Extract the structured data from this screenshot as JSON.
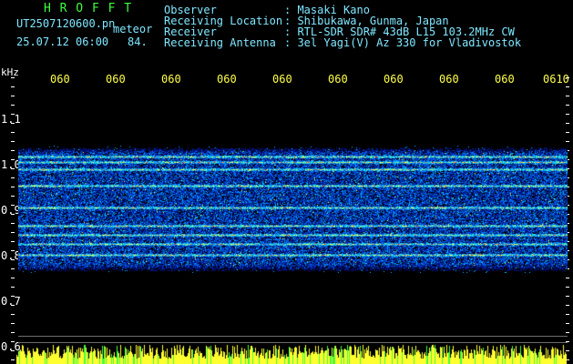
{
  "header": {
    "brand": "H R O F F T",
    "filename": "UT2507120600.pn",
    "meteor_word": "meteor",
    "datetime": "25.07.12 06:00",
    "count": "84.",
    "fields": [
      {
        "label": "Observer",
        "value": ": Masaki Kano"
      },
      {
        "label": "Receiving Location",
        "value": ": Shibukawa, Gunma, Japan"
      },
      {
        "label": "Receiver",
        "value": ": RTL-SDR SDR# 43dB L15 103.2MHz CW"
      },
      {
        "label": "Receiving Antenna",
        "value": ": 3el Yagi(V) Az 330 for Vladivostok"
      }
    ]
  },
  "axis": {
    "unit": "kHz",
    "y_labels": [
      "1.1",
      "1.0",
      "0.9",
      "0.8",
      "0.7",
      "0.6"
    ],
    "time_ticks": [
      "060",
      "060",
      "060",
      "060",
      "060",
      "060",
      "060",
      "060",
      "060",
      "0610"
    ]
  },
  "colors": {
    "background": "#000000",
    "brand": "#3cff3c",
    "header_text": "#7fe7ff",
    "tick_text": "#ffff4a",
    "spectro_low": "#001a8a",
    "spectro_mid": "#00a8ff",
    "spectro_high": "#ffff30",
    "spectro_peak": "#ff3020"
  }
}
